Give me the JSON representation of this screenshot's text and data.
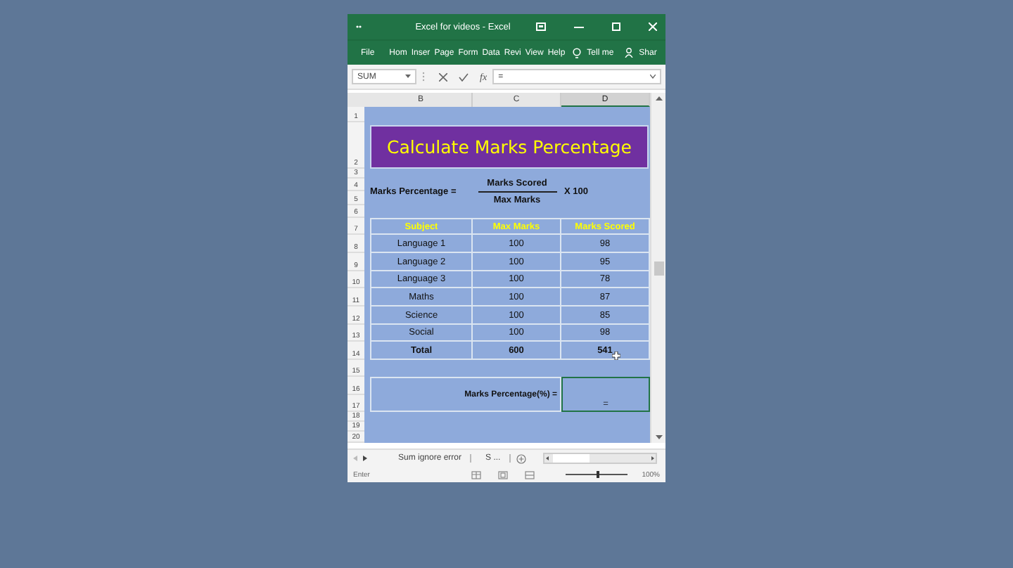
{
  "window": {
    "title": "Excel for videos  -  Excel"
  },
  "ribbon": {
    "tabs": [
      "File",
      "Hom",
      "Inser",
      "Page",
      "Form",
      "Data",
      "Revi",
      "View",
      "Help"
    ],
    "tell_me": "Tell me",
    "share": "Shar"
  },
  "formula_bar": {
    "name_box": "SUM",
    "function_label": "fx",
    "formula": "="
  },
  "columns": [
    {
      "label": "B",
      "selected": false
    },
    {
      "label": "C",
      "selected": false
    },
    {
      "label": "D",
      "selected": true
    }
  ],
  "row_numbers": [
    "1",
    "2",
    "3",
    "4",
    "5",
    "6",
    "7",
    "8",
    "9",
    "10",
    "11",
    "12",
    "13",
    "14",
    "15",
    "16",
    "17",
    "18",
    "19",
    "20"
  ],
  "title": "Calculate Marks Percentage",
  "formula": {
    "label": "Marks Percentage =",
    "numerator": "Marks Scored",
    "denominator": "Max Marks",
    "multiplier": "X 100"
  },
  "table": {
    "columns": [
      "Subject",
      "Max Marks",
      "Marks Scored"
    ],
    "rows": [
      [
        "Language 1",
        "100",
        "98"
      ],
      [
        "Language 2",
        "100",
        "95"
      ],
      [
        "Language 3",
        "100",
        "78"
      ],
      [
        "Maths",
        "100",
        "87"
      ],
      [
        "Science",
        "100",
        "85"
      ],
      [
        "Social",
        "100",
        "98"
      ]
    ],
    "total": [
      "Total",
      "600",
      "541"
    ]
  },
  "result": {
    "label": "Marks Percentage(%) =",
    "value": "=",
    "selected": true
  },
  "sheet_tabs": [
    "Sum ignore error",
    "S ..."
  ],
  "status_bar": {
    "mode": "Enter",
    "zoom": "100%",
    "level": 0.5
  }
}
